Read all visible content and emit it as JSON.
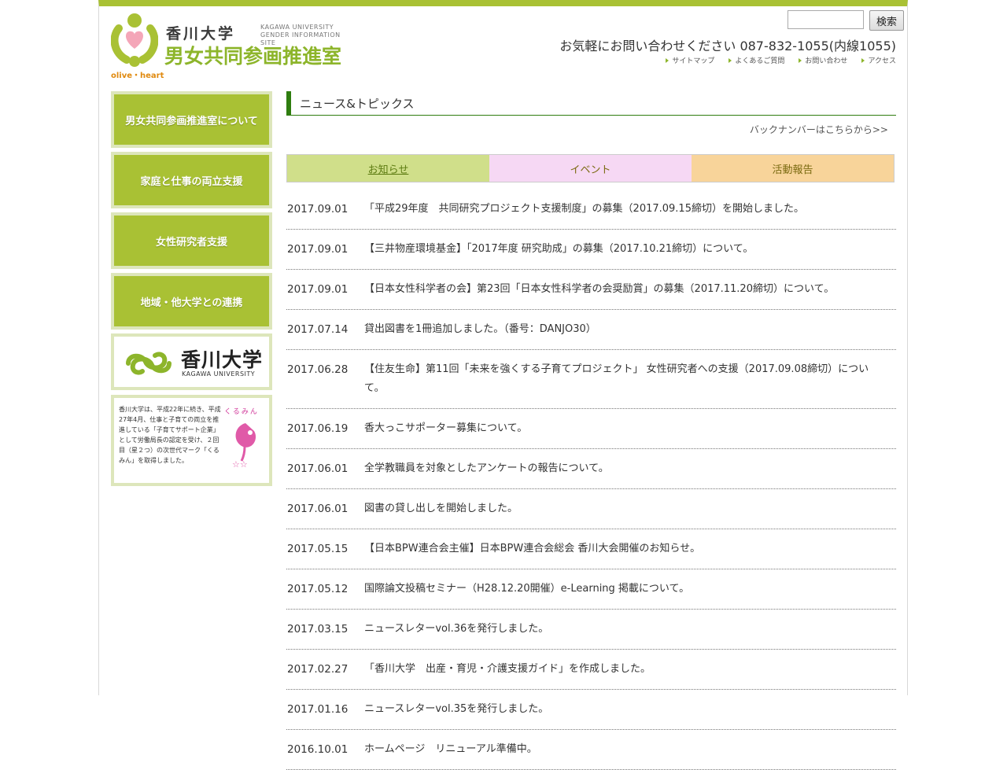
{
  "header": {
    "logo_univ": "香川大学",
    "logo_en_line1": "KAGAWA UNIVERSITY",
    "logo_en_line2": "GENDER INFORMATION SITE",
    "logo_title": "男女共同参画推進室",
    "logo_tagline": "olive・heart",
    "search_value": "",
    "search_button": "検索",
    "contact": "お気軽にお問い合わせください 087-832-1055(内線1055)",
    "links": [
      "サイトマップ",
      "よくあるご質問",
      "お問い合わせ",
      "アクセス"
    ]
  },
  "sidebar": {
    "items": [
      "男女共同参画推進室について",
      "家庭と仕事の両立支援",
      "女性研究者支援",
      "地域・他大学との連携"
    ],
    "banner_univ": "香川大学",
    "banner_en": "KAGAWA UNIVERSITY",
    "info_text": "香川大学は、平成22年に続き、平成27年4月、仕事と子育ての両立を推進している「子育てサポート企業」として労働局長の認定を受け、２回目（星２つ）の次世代マーク「くるみん」を取得しました。",
    "kurumin_label": "くるみん"
  },
  "main": {
    "section_title": "ニュース&トピックス",
    "back_number": "バックナンバーはこちらから>>",
    "tabs": [
      "お知らせ",
      "イベント",
      "活動報告"
    ],
    "news": [
      {
        "date": "2017.09.01",
        "title": "「平成29年度　共同研究プロジェクト支援制度」の募集（2017.09.15締切）を開始しました。"
      },
      {
        "date": "2017.09.01",
        "title": "【三井物産環境基金】「2017年度 研究助成」の募集（2017.10.21締切）について。"
      },
      {
        "date": "2017.09.01",
        "title": "【日本女性科学者の会】第23回「日本女性科学者の会奨励賞」の募集（2017.11.20締切）について。"
      },
      {
        "date": "2017.07.14",
        "title": "貸出図書を1冊追加しました。（番号：DANJO30）"
      },
      {
        "date": "2017.06.28",
        "title": "【住友生命】第11回「未来を強くする子育てプロジェクト」 女性研究者への支援（2017.09.08締切）について。"
      },
      {
        "date": "2017.06.19",
        "title": "香大っこサポーター募集について。"
      },
      {
        "date": "2017.06.01",
        "title": "全学教職員を対象としたアンケートの報告について。"
      },
      {
        "date": "2017.06.01",
        "title": "図書の貸し出しを開始しました。"
      },
      {
        "date": "2017.05.15",
        "title": "【日本BPW連合会主催】日本BPW連合会総会 香川大会開催のお知らせ。"
      },
      {
        "date": "2017.05.12",
        "title": "国際論文投稿セミナー（H28.12.20開催）e-Learning 掲載について。"
      },
      {
        "date": "2017.03.15",
        "title": "ニュースレターvol.36を発行しました。"
      },
      {
        "date": "2017.02.27",
        "title": "「香川大学　出産・育児・介護支援ガイド」を作成しました。"
      },
      {
        "date": "2017.01.16",
        "title": "ニュースレターvol.35を発行しました。"
      },
      {
        "date": "2016.10.01",
        "title": "ホームページ　リニューアル準備中。"
      }
    ]
  },
  "colors": {
    "brand_green": "#a9c134",
    "dark_green": "#2f7d0f",
    "tab_info": "#d0df8a",
    "tab_event": "#f6d8f4",
    "tab_report": "#f8d49a"
  }
}
